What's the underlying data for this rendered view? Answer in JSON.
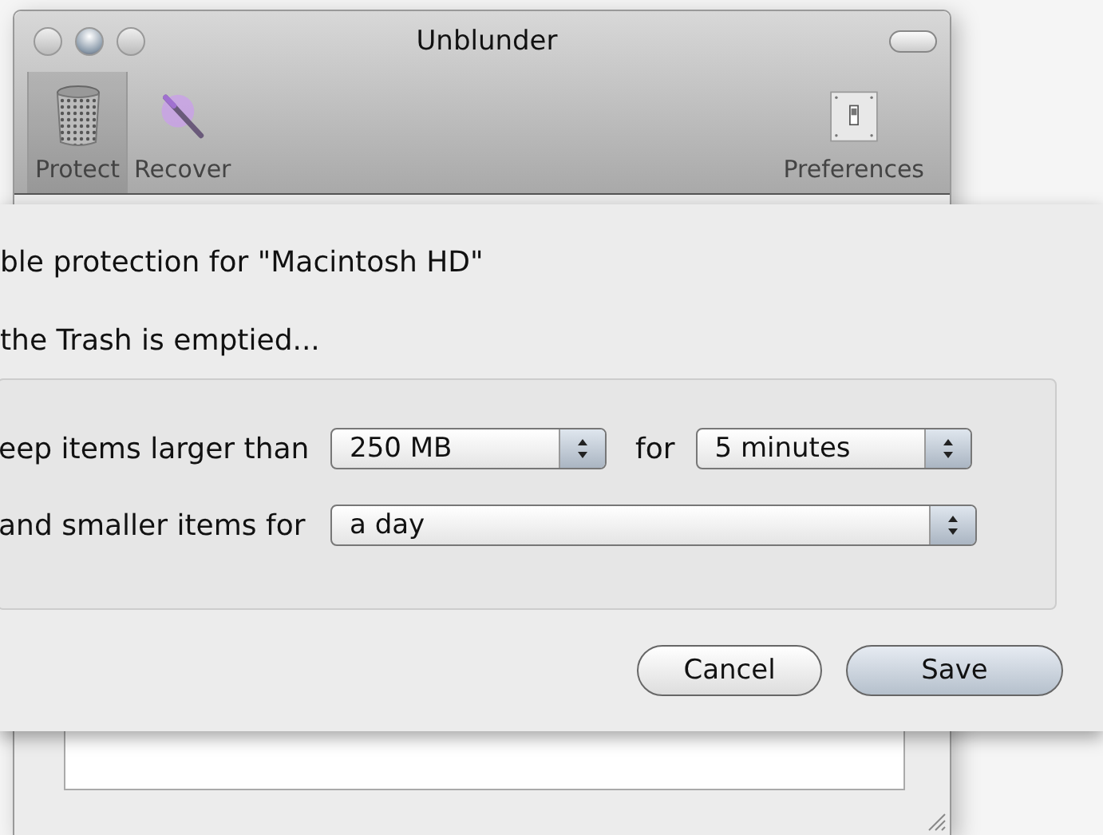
{
  "window": {
    "title": "Unblunder"
  },
  "toolbar": {
    "items": [
      {
        "label": "Protect",
        "selected": true
      },
      {
        "label": "Recover",
        "selected": false
      },
      {
        "label": "Preferences",
        "selected": false
      }
    ]
  },
  "sheet": {
    "heading": "ble protection for \"Macintosh HD\"",
    "subheading": "the Trash is emptied...",
    "rows": [
      {
        "label": "eep items larger than",
        "popups": [
          {
            "value": "250 MB"
          },
          {
            "joiner": "for",
            "value": "5 minutes"
          }
        ]
      },
      {
        "label": "and smaller items for",
        "popups": [
          {
            "value": "a day"
          }
        ]
      }
    ],
    "buttons": [
      {
        "label": "Cancel",
        "default": false
      },
      {
        "label": "Save",
        "default": true
      }
    ]
  }
}
